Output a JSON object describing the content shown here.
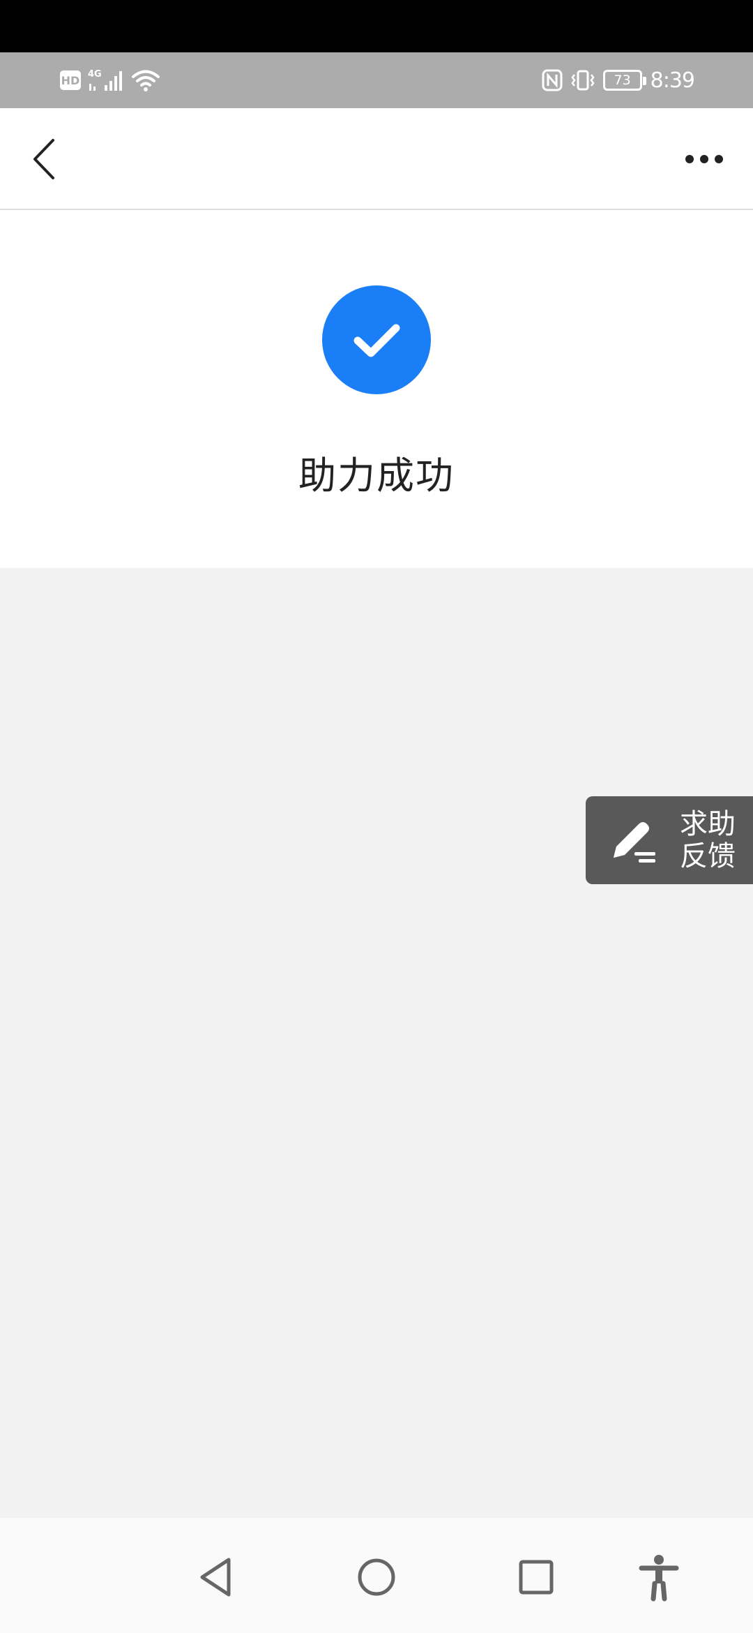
{
  "status_bar": {
    "hd_label": "HD",
    "network_label": "4G",
    "battery_level": "73",
    "time": "8:39",
    "icons": [
      "hd-icon",
      "signal-icon",
      "wifi-icon",
      "nfc-icon",
      "vibrate-icon",
      "battery-icon"
    ]
  },
  "nav_bar": {
    "back_icon": "chevron-left-icon",
    "more_icon": "more-dots-icon"
  },
  "result": {
    "icon": "checkmark-icon",
    "icon_color": "#1a7ef6",
    "title": "助力成功"
  },
  "feedback": {
    "icon": "edit-pen-icon",
    "label": "求助\n反馈",
    "line1": "求助",
    "line2": "反馈"
  },
  "system_nav": {
    "buttons": [
      "back-triangle-icon",
      "home-circle-icon",
      "recent-square-icon",
      "accessibility-icon"
    ]
  }
}
